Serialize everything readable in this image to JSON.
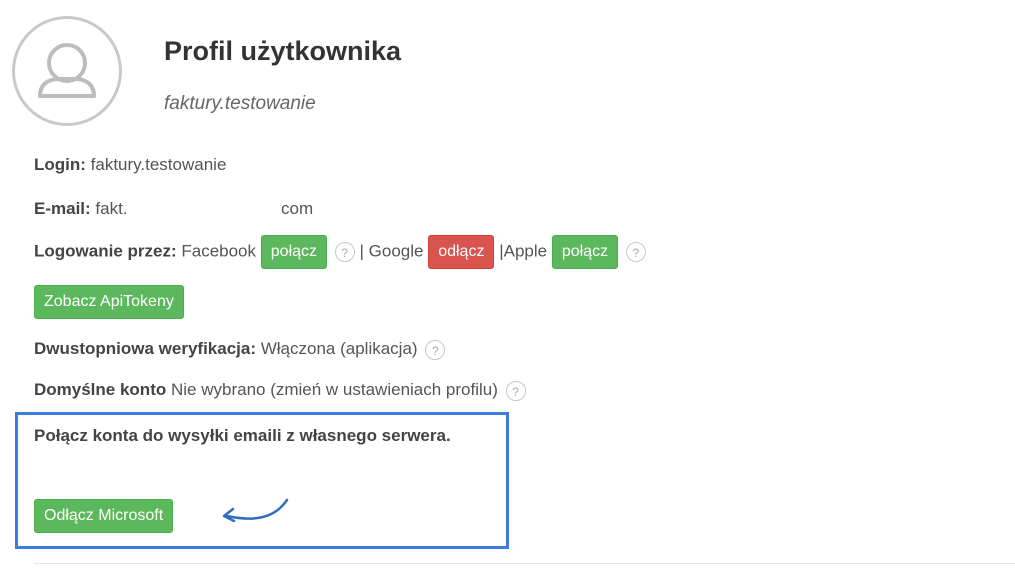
{
  "profile": {
    "title": "Profil użytkownika",
    "subtitle": "faktury.testowanie",
    "avatar_icon": "user-icon"
  },
  "login": {
    "label": "Login:",
    "value": "faktury.testowanie"
  },
  "email": {
    "label": "E-mail:",
    "value_start": "fakt.",
    "value_end": "com"
  },
  "social": {
    "label": "Logowanie przez:",
    "facebook": {
      "name": "Facebook",
      "button": "połącz"
    },
    "separator": "|",
    "google": {
      "name": "Google",
      "button": "odłącz"
    },
    "apple": {
      "name": "Apple",
      "button": "połącz"
    },
    "help_glyph": "?"
  },
  "api_tokens_button": "Zobacz ApiTokeny",
  "two_factor": {
    "label": "Dwustopniowa weryfikacja:",
    "value": "Włączona (aplikacja)"
  },
  "default_account": {
    "label": "Domyślne konto",
    "value": "Nie wybrano (zmień w ustawieniach profilu)"
  },
  "mail_servers": {
    "heading": "Połącz konta do wysyłki emaili z własnego serwera.",
    "microsoft_button": "Odłącz Microsoft"
  },
  "colors": {
    "green": "#5cb85c",
    "red": "#d9534f",
    "highlight": "#3b7ddd"
  }
}
